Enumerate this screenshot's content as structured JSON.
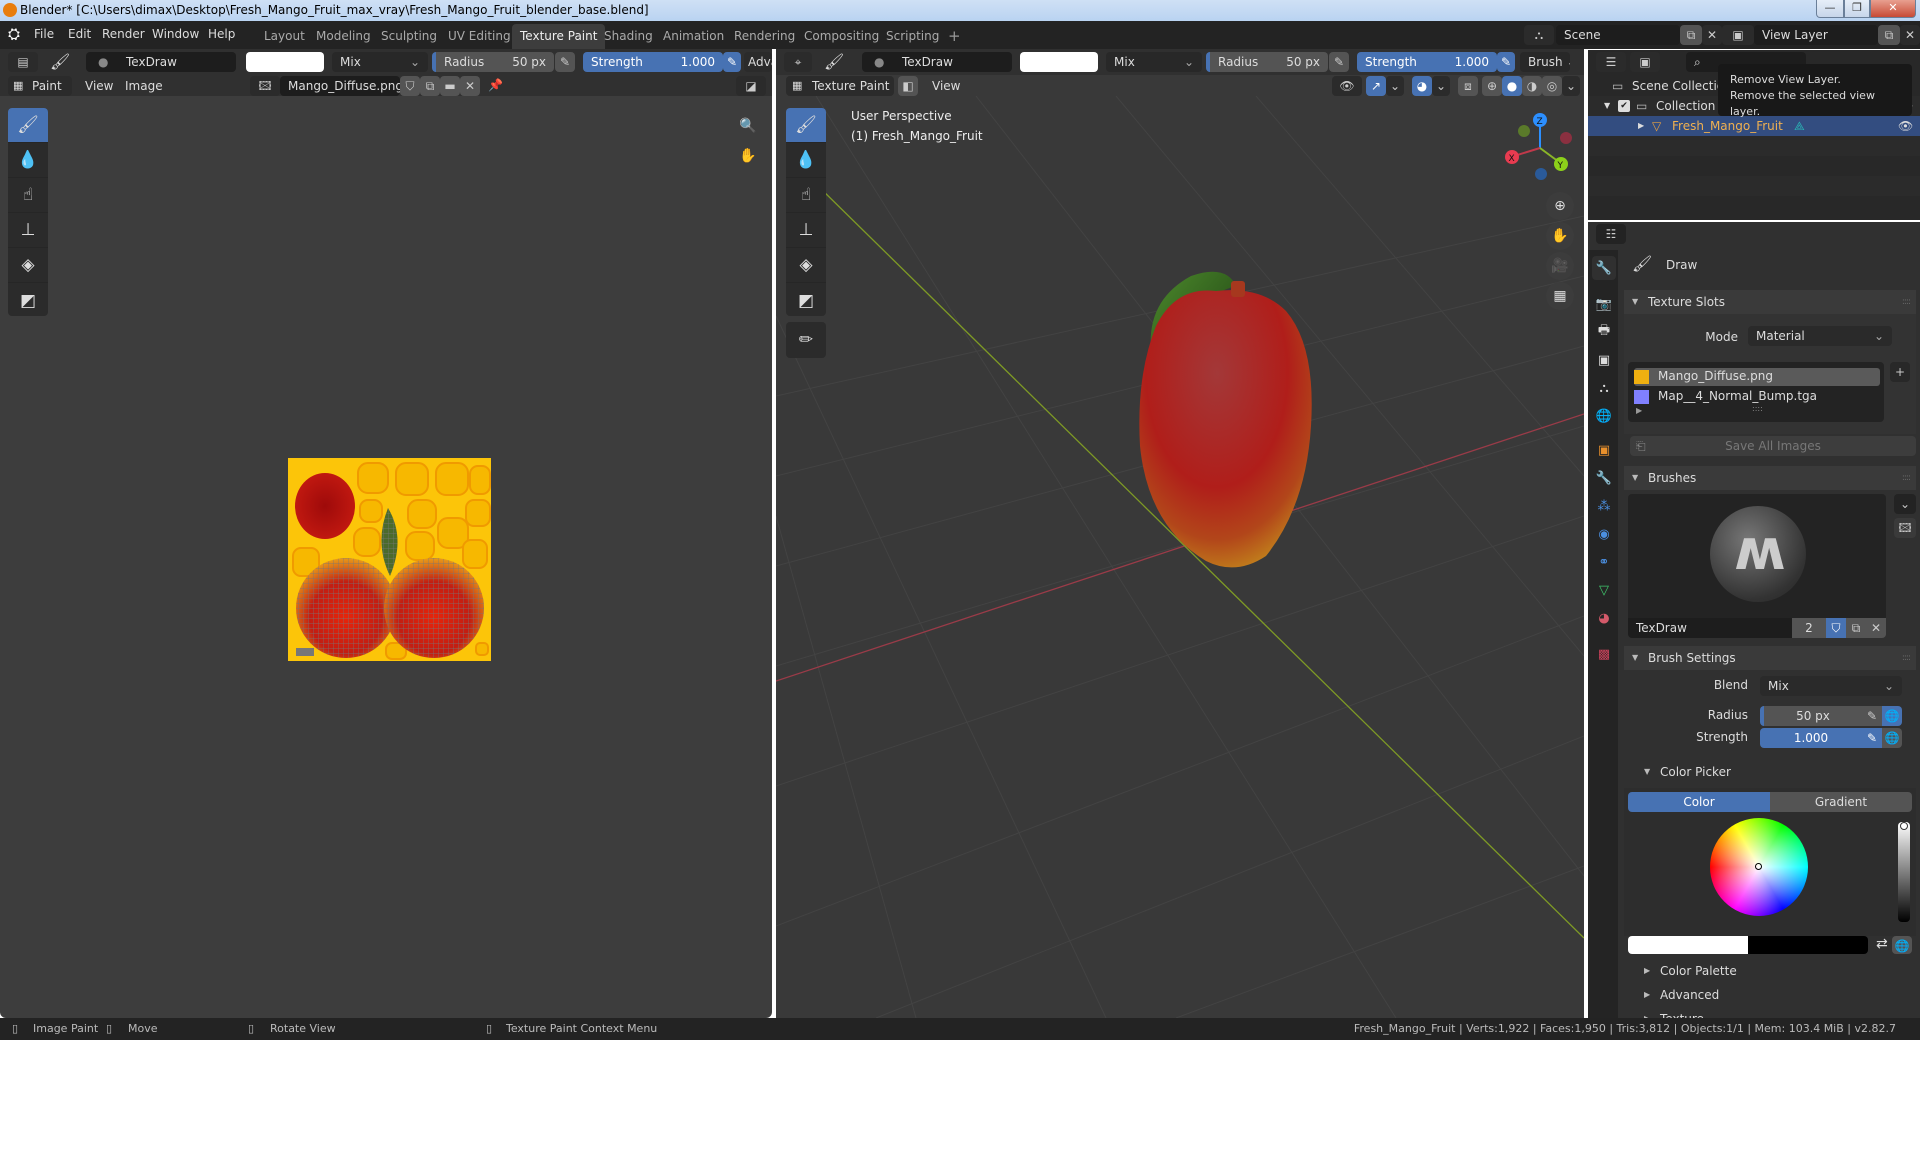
{
  "window": {
    "title": "Blender* [C:\\Users\\dimax\\Desktop\\Fresh_Mango_Fruit_max_vray\\Fresh_Mango_Fruit_blender_base.blend]",
    "minimize": "—",
    "maximize": "❐",
    "close": "✕"
  },
  "menubar": {
    "items": [
      "File",
      "Edit",
      "Render",
      "Window",
      "Help"
    ]
  },
  "workspaces": {
    "tabs": [
      "Layout",
      "Modeling",
      "Sculpting",
      "UV Editing",
      "Texture Paint",
      "Shading",
      "Animation",
      "Rendering",
      "Compositing",
      "Scripting"
    ],
    "active": "Texture Paint",
    "add": "+"
  },
  "scene": {
    "name": "Scene",
    "view_layer": "View Layer"
  },
  "image_editor": {
    "tool_header": {
      "brush": "TexDraw",
      "blend": "Mix",
      "radius_label": "Radius",
      "radius_value": "50 px",
      "strength_label": "Strength",
      "strength_value": "1.000",
      "advanced": "Adva"
    },
    "header": {
      "mode": "Paint",
      "menus": [
        "View",
        "Image"
      ],
      "image_name": "Mango_Diffuse.png"
    },
    "tools": [
      "draw",
      "soften",
      "smear",
      "clone",
      "fill",
      "mask"
    ]
  },
  "viewport": {
    "tool_header": {
      "brush": "TexDraw",
      "blend": "Mix",
      "radius_label": "Radius",
      "radius_value": "50 px",
      "strength_label": "Strength",
      "strength_value": "1.000",
      "brush_menu": "Brush"
    },
    "header": {
      "mode": "Texture Paint",
      "menus": [
        "View"
      ]
    },
    "overlay_text": {
      "perspective": "User Perspective",
      "object": "(1) Fresh_Mango_Fruit"
    },
    "gizmo": {
      "x": "X",
      "y": "Y",
      "z": "Z"
    },
    "colors": {
      "x_axis": "#c0394a",
      "y_axis": "#8ab528",
      "z_axis": "#2c8fff"
    }
  },
  "outliner": {
    "tooltip_title": "Remove View Layer.",
    "tooltip_desc": "Remove the selected view layer.",
    "rows": [
      {
        "label": "Scene Collection"
      },
      {
        "label": "Collection"
      },
      {
        "label": "Fresh_Mango_Fruit",
        "selected": true
      }
    ]
  },
  "properties": {
    "tool_name": "Draw",
    "texture_slots": {
      "title": "Texture Slots",
      "mode_label": "Mode",
      "mode_value": "Material",
      "slots": [
        {
          "name": "Mango_Diffuse.png",
          "selected": true
        },
        {
          "name": "Map__4_Normal_Bump.tga",
          "selected": false
        }
      ],
      "save_all": "Save All Images"
    },
    "brushes": {
      "title": "Brushes",
      "brush_name": "TexDraw",
      "users": "2"
    },
    "brush_settings": {
      "title": "Brush Settings",
      "blend_label": "Blend",
      "blend_value": "Mix",
      "radius_label": "Radius",
      "radius_value": "50 px",
      "strength_label": "Strength",
      "strength_value": "1.000",
      "strength_fraction": 1.0
    },
    "color_picker": {
      "title": "Color Picker",
      "tab_color": "Color",
      "tab_gradient": "Gradient",
      "primary_color": "#ffffff",
      "secondary_color": "#000000"
    },
    "collapsed": [
      "Color Palette",
      "Advanced",
      "Texture"
    ]
  },
  "statusbar": {
    "hints": [
      "Image Paint",
      "Move",
      "Rotate View",
      "Texture Paint Context Menu"
    ],
    "stats": "Fresh_Mango_Fruit | Verts:1,922 | Faces:1,950 | Tris:3,812 | Objects:1/1 | Mem: 103.4 MiB | v2.82.7"
  }
}
